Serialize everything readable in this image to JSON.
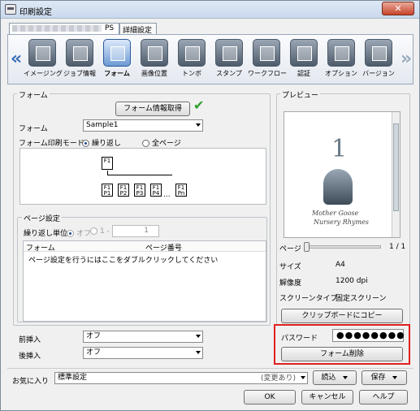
{
  "window": {
    "title": "印刷設定",
    "close": "✕"
  },
  "tabs": [
    {
      "label": "PS"
    },
    {
      "label": "詳細設定"
    }
  ],
  "toolbar": {
    "left_arrow": "«",
    "right_arrow": "»",
    "items": [
      {
        "label": "イメージング",
        "icon": "imaging-icon"
      },
      {
        "label": "ジョブ情報",
        "icon": "job-info-icon"
      },
      {
        "label": "フォーム",
        "icon": "form-icon"
      },
      {
        "label": "画像位置",
        "icon": "image-position-icon"
      },
      {
        "label": "トンボ",
        "icon": "crop-mark-icon"
      },
      {
        "label": "スタンプ",
        "icon": "stamp-icon"
      },
      {
        "label": "ワークフロー",
        "icon": "workflow-icon"
      },
      {
        "label": "認証",
        "icon": "authentication-icon"
      },
      {
        "label": "オプション",
        "icon": "option-icon"
      },
      {
        "label": "バージョン",
        "icon": "version-icon"
      }
    ]
  },
  "form_group": {
    "title": "フォーム",
    "get_info_button": "フォーム情報取得",
    "form_label": "フォーム",
    "form_value": "Sample1",
    "mode_label": "フォーム印刷モード",
    "mode_repeat": "繰り返し",
    "mode_all": "全ページ"
  },
  "diagram": {
    "root": "F1",
    "children": [
      "P1",
      "P2",
      "P3",
      "P4",
      "Pn"
    ],
    "child_top": "F1",
    "ellipsis": "..."
  },
  "page_settings": {
    "title": "ページ設定",
    "unit_label": "繰り返し単位",
    "off_label": "オフ",
    "one_label": "1 -",
    "spinner_value": "1",
    "col_form": "フォーム",
    "col_page": "ページ番号",
    "hint": "ページ設定を行うにはここをダブルクリックしてください"
  },
  "inserts": {
    "pre_label": "前挿入",
    "pre_value": "オフ",
    "post_label": "後挿入",
    "post_value": "オフ"
  },
  "preview": {
    "title": "プレビュー",
    "big_number": "1",
    "caption_line1": "Mother Goose",
    "caption_line2": "Nursery Rhymes",
    "page_label": "ページ",
    "page_count": "1 / 1",
    "page_position": 0,
    "size_label": "サイズ",
    "size_value": "A4",
    "resolution_label": "解像度",
    "resolution_value": "1200 dpi",
    "screen_label": "スクリーンタイプ",
    "screen_value": "固定スクリーン",
    "clipboard_button": "クリップボードにコピー"
  },
  "password": {
    "label": "パスワード",
    "value": "●●●●●●●●",
    "delete_button": "フォーム削除"
  },
  "favorites": {
    "label": "お気に入り",
    "value": "標準設定",
    "status": "(変更あり)",
    "load_button": "読込",
    "save_button": "保存"
  },
  "footer": {
    "ok": "OK",
    "cancel": "キャンセル",
    "help": "ヘルプ"
  }
}
